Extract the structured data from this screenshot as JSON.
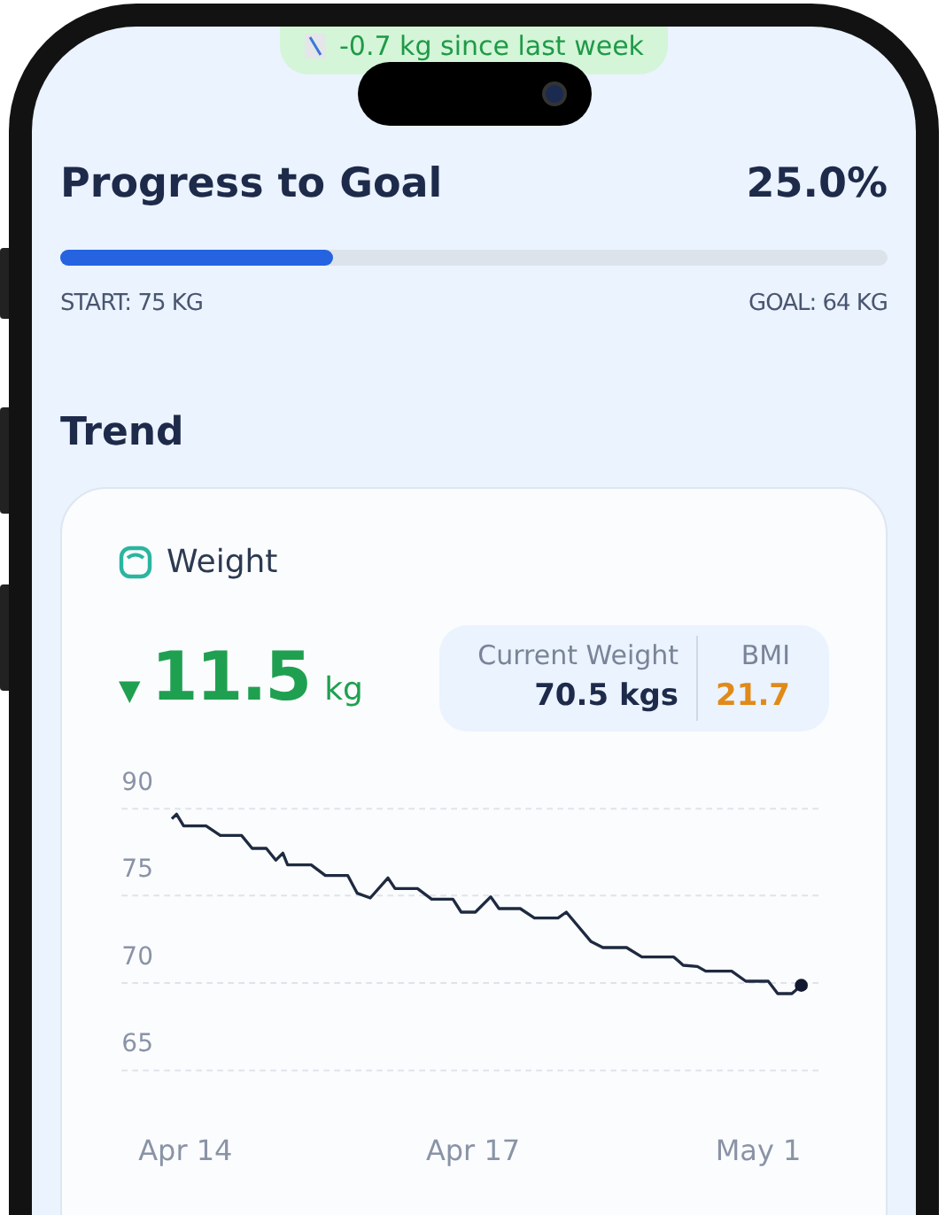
{
  "banner": {
    "text": "-0.7 kg since last week"
  },
  "progress": {
    "title": "Progress to Goal",
    "percent": "25.0%",
    "level": 0.33,
    "start": "START: 75 KG",
    "goal": "GOAL: 64 KG"
  },
  "trend": {
    "title": "Trend",
    "card": {
      "title": "Weight",
      "change": {
        "arrow": "▼",
        "value": "11.5",
        "unit": "kg"
      },
      "stats": [
        {
          "label": "Current Weight",
          "value": "70.5 kgs",
          "color": "#1e2a4a"
        },
        {
          "label": "BMI",
          "value": "21.7",
          "color": "#e08a1a"
        }
      ],
      "chart": {
        "y_labels": [
          "90",
          "75",
          "70",
          "65"
        ],
        "x_labels": [
          "Apr 14",
          "Apr 17",
          "May 1"
        ]
      }
    }
  }
}
